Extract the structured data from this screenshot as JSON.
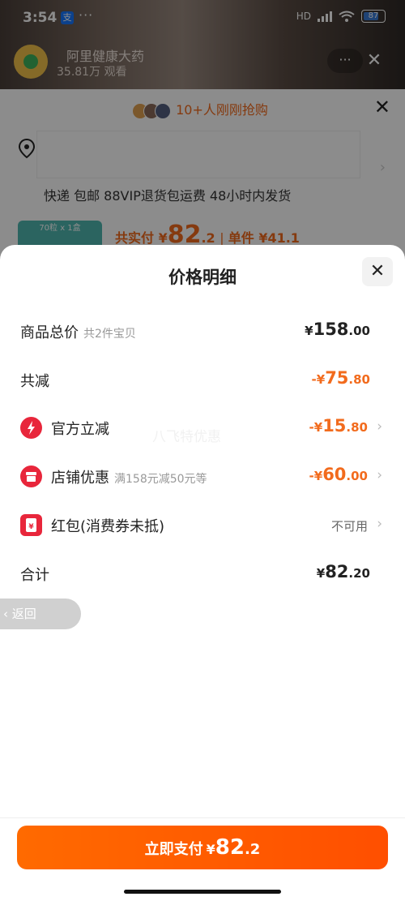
{
  "status_bar": {
    "time": "3:54",
    "app_badge": "支",
    "dots": "···",
    "network": "HD",
    "battery": "87"
  },
  "live": {
    "name": "阿里健康大药",
    "viewers": "35.81万 观看",
    "more": "···",
    "close": "✕"
  },
  "order": {
    "hot_text": "10+人刚刚抢购",
    "shipping": "快递 包邮 88VIP退货包运费 48小时内发货",
    "thumb_text": "70粒 x 1盒",
    "total_label": "共实付 ¥",
    "total_int": "82",
    "total_dec": ".2",
    "unit_label": "单件 ¥41.1"
  },
  "detail": {
    "title": "价格明细",
    "rows": {
      "subtotal": {
        "label": "商品总价",
        "sub": "共2件宝贝",
        "yen": "¥",
        "int": "158",
        "dec": ".00"
      },
      "discount": {
        "label": "共减",
        "yen": "-¥",
        "int": "75",
        "dec": ".80"
      },
      "official": {
        "label": "官方立减",
        "yen": "-¥",
        "int": "15",
        "dec": ".80"
      },
      "store": {
        "label": "店铺优惠",
        "sub": "满158元减50元等",
        "yen": "-¥",
        "int": "60",
        "dec": ".00"
      },
      "redpacket": {
        "label": "红包(消费券未抵)",
        "status": "不可用"
      },
      "total": {
        "label": "合计",
        "yen": "¥",
        "int": "82",
        "dec": ".20"
      }
    },
    "watermark": "八飞特优惠",
    "back": "返回",
    "pay": {
      "label": "立即支付",
      "yen": "¥",
      "int": "82",
      "dec": ".2"
    }
  },
  "colors": {
    "accent": "#f26b1d",
    "pay_button": "#ff5a00",
    "icon_red": "#e8263b"
  }
}
